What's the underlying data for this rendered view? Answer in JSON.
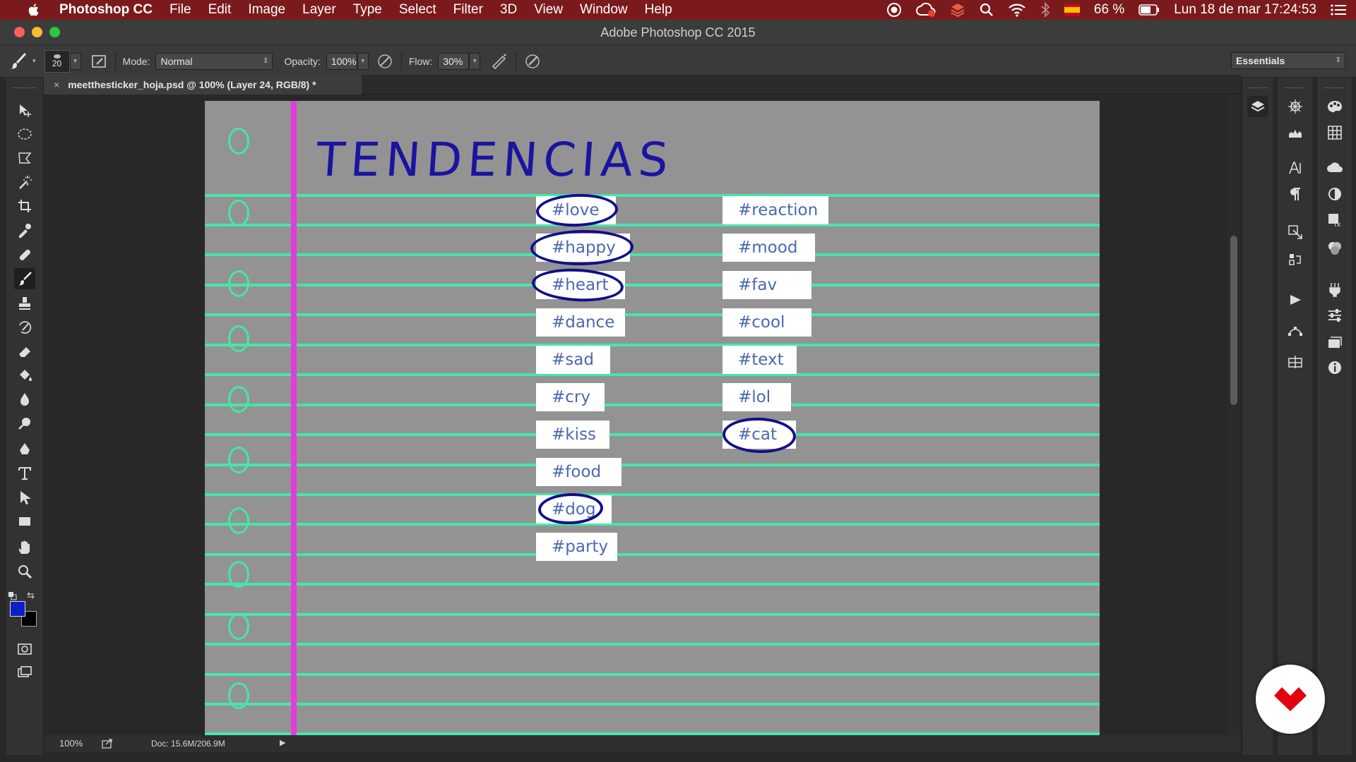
{
  "menubar": {
    "app_name": "Photoshop CC",
    "menus": [
      "File",
      "Edit",
      "Image",
      "Layer",
      "Type",
      "Select",
      "Filter",
      "3D",
      "View",
      "Window",
      "Help"
    ],
    "battery": "66 %",
    "datetime": "Lun 18 de mar  17:24:53"
  },
  "window": {
    "title": "Adobe Photoshop CC 2015"
  },
  "options": {
    "brush_size": "20",
    "mode_label": "Mode:",
    "mode_value": "Normal",
    "opacity_label": "Opacity:",
    "opacity_value": "100%",
    "flow_label": "Flow:",
    "flow_value": "30%",
    "workspace": "Essentials"
  },
  "document": {
    "tab_title": "meetthesticker_hoja.psd @ 100% (Layer 24, RGB/8) *",
    "title_text": "TENDENCIAS",
    "col1": [
      "#love",
      "#happy",
      "#heart",
      "#dance",
      "#sad",
      "#cry",
      "#kiss",
      "#food",
      "#dog",
      "#party"
    ],
    "col2": [
      "#reaction",
      "#mood",
      "#fav",
      "#cool",
      "#text",
      "#lol",
      "#cat"
    ],
    "circled": [
      "#love",
      "#happy",
      "#heart",
      "#dog",
      "#cat"
    ]
  },
  "status": {
    "zoom": "100%",
    "doc_info": "Doc: 15.6M/206.9M"
  },
  "colors": {
    "foreground": "#0b1fc4",
    "background": "#000000",
    "rule": "#43e8a8",
    "margin": "#e13ddc",
    "ink": "#1b14a0"
  }
}
